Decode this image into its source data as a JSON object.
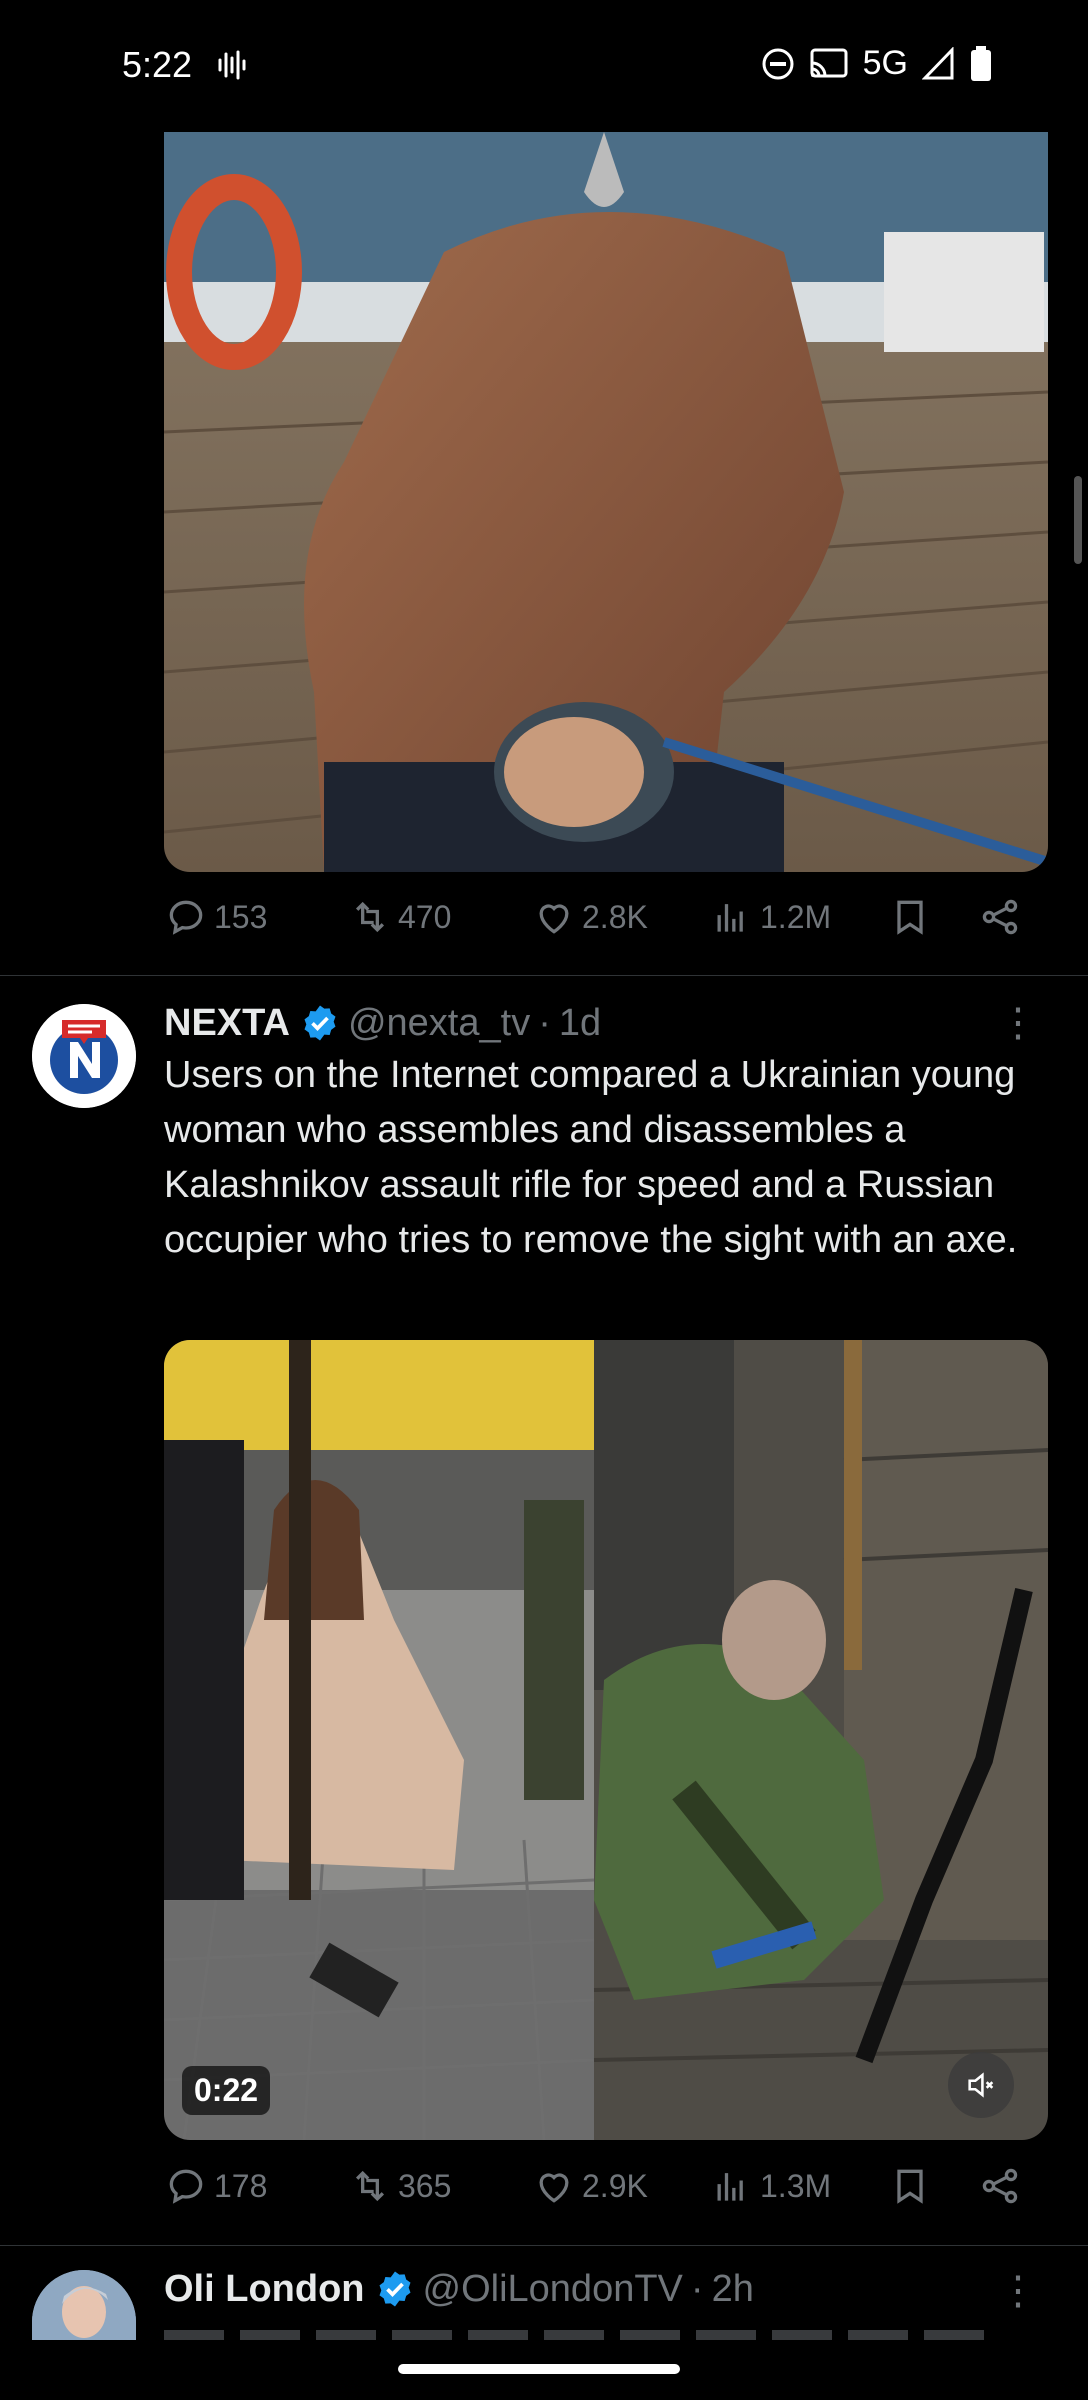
{
  "status_bar": {
    "time": "5:22",
    "network": "5G",
    "icons": [
      "sound-wave-icon",
      "do-not-disturb-icon",
      "cast-icon",
      "signal-icon",
      "battery-icon"
    ]
  },
  "tweet_prev": {
    "image_desc_icon": "image",
    "actions": {
      "replies": "153",
      "retweets": "470",
      "likes": "2.8K",
      "views": "1.2M"
    }
  },
  "tweet_nexta": {
    "name": "NEXTA",
    "handle": "@nexta_tv",
    "sep": "·",
    "time": "1d",
    "more": "⋮",
    "text": "Users on the Internet compared a Ukrainian young woman who assembles and disassembles a Kalashnikov assault rifle for speed and a Russian occupier who tries to remove the sight with an axe.",
    "video_duration": "0:22",
    "actions": {
      "replies": "178",
      "retweets": "365",
      "likes": "2.9K",
      "views": "1.3M"
    }
  },
  "tweet_next": {
    "name": "Oli London",
    "handle": "@OliLondonTV",
    "sep": "·",
    "time": "2h",
    "more": "⋮"
  },
  "colors": {
    "background": "#000000",
    "text": "#e7e9ea",
    "muted": "#71767b",
    "verified": "#1d9bf0",
    "divider": "#2f3336"
  }
}
